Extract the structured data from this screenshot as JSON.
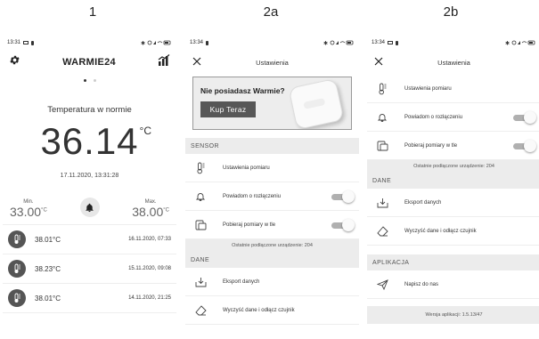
{
  "panels": [
    {
      "label": "1"
    },
    {
      "label": "2a"
    },
    {
      "label": "2b"
    }
  ],
  "screen1": {
    "time": "13:31",
    "app_title": "WARMIE24",
    "temp_status": "Temperatura w normie",
    "temperature": "36.14",
    "unit": "°C",
    "datetime": "17.11.2020, 13:31:28",
    "min_label": "Min.",
    "min_value": "33.00",
    "max_label": "Max.",
    "max_value": "38.00",
    "history": [
      {
        "temp": "38.01°C",
        "time": "16.11.2020, 07:33"
      },
      {
        "temp": "38.23°C",
        "time": "15.11.2020, 09:08"
      },
      {
        "temp": "38.01°C",
        "time": "14.11.2020, 21:25"
      }
    ]
  },
  "screen2a": {
    "time": "13:34",
    "title": "Ustawienia",
    "banner_question": "Nie posiadasz Warmie?",
    "banner_button": "Kup Teraz",
    "section_sensor": "SENSOR",
    "item_settings": "Ustawienia pomiaru",
    "item_notify": "Powiadom o rozłączeniu",
    "item_background": "Pobieraj pomiary w tle",
    "last_device": "Ostatnie podłączone urządzenie: 204",
    "section_data": "DANE",
    "item_export": "Eksport danych",
    "item_clear": "Wyczyść dane i odłącz czujnik"
  },
  "screen2b": {
    "time": "13:34",
    "title": "Ustawienia",
    "item_settings": "Ustawienia pomiaru",
    "item_notify": "Powiadom o rozłączeniu",
    "item_background": "Pobieraj pomiary w tle",
    "last_device": "Ostatnie podłączone urządzenie: 204",
    "section_data": "DANE",
    "item_export": "Eksport danych",
    "item_clear": "Wyczyść dane i odłącz czujnik",
    "section_app": "APLIKACJA",
    "item_write": "Napisz do nas",
    "version": "Wersja aplikacji: 1.5.13/47"
  },
  "colors": {
    "dark": "#333333",
    "section_bg": "#ececec",
    "button_bg": "#575757",
    "toggle_track": "#b0b0b0"
  },
  "icons": [
    "gear-icon",
    "chart-icon",
    "bell-icon",
    "thermometer-icon",
    "close-icon",
    "phone-icon",
    "download-icon",
    "eraser-icon",
    "send-icon"
  ]
}
